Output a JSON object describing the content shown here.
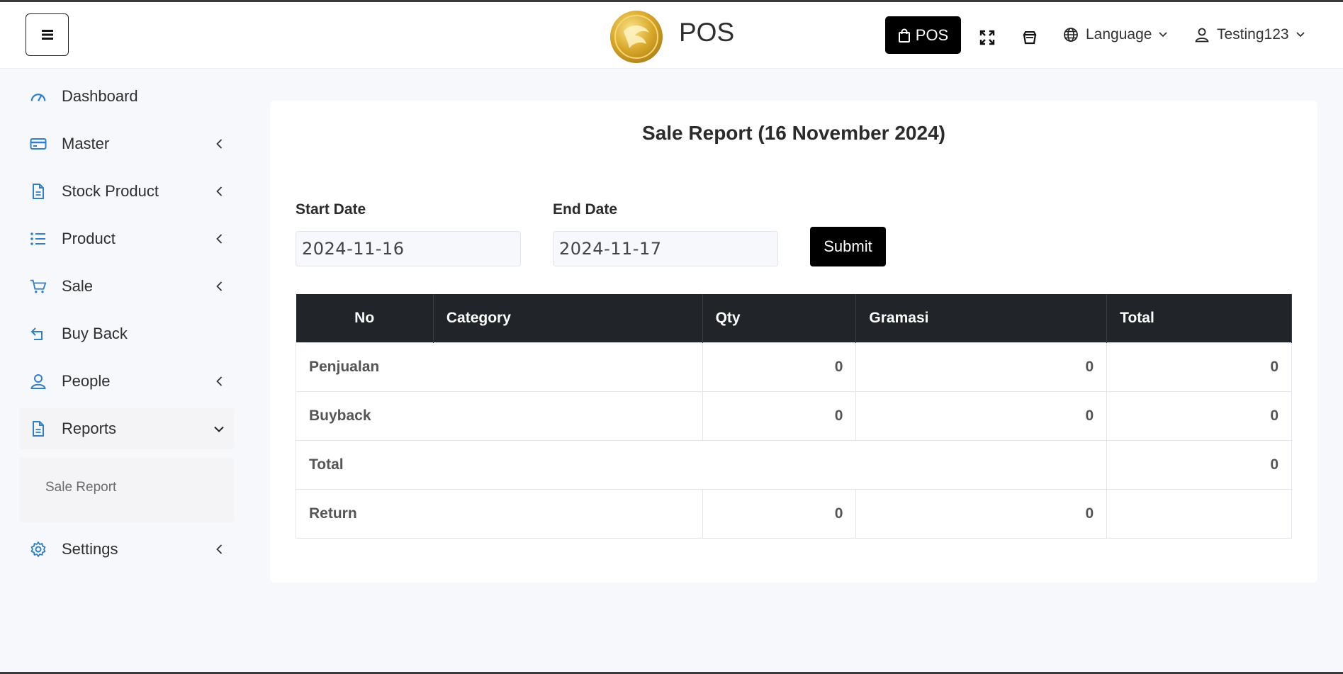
{
  "header": {
    "brand": "POS",
    "pos_button": "POS",
    "language": "Language",
    "user": "Testing123"
  },
  "sidebar": {
    "items": [
      {
        "label": "Dashboard",
        "icon": "dashboard-gauge-icon",
        "has_chevron": false
      },
      {
        "label": "Master",
        "icon": "card-icon",
        "has_chevron": true
      },
      {
        "label": "Stock Product",
        "icon": "document-icon",
        "has_chevron": true
      },
      {
        "label": "Product",
        "icon": "list-icon",
        "has_chevron": true
      },
      {
        "label": "Sale",
        "icon": "cart-icon",
        "has_chevron": true
      },
      {
        "label": "Buy Back",
        "icon": "return-arrow-icon",
        "has_chevron": false
      },
      {
        "label": "People",
        "icon": "user-icon",
        "has_chevron": true
      },
      {
        "label": "Reports",
        "icon": "document-icon",
        "has_chevron": true,
        "expanded": true
      },
      {
        "label": "Settings",
        "icon": "gear-icon",
        "has_chevron": true
      }
    ],
    "reports_submenu": [
      "Sale Report"
    ]
  },
  "main": {
    "title": "Sale Report (16 November 2024)",
    "start_date_label": "Start Date",
    "start_date_value": "2024-11-16",
    "end_date_label": "End Date",
    "end_date_value": "2024-11-17",
    "submit_label": "Submit",
    "table": {
      "headers": [
        "No",
        "Category",
        "Qty",
        "Gramasi",
        "Total"
      ],
      "rows": [
        {
          "category": "Penjualan",
          "qty": "0",
          "gramasi": "0",
          "total": "0"
        },
        {
          "category": "Buyback",
          "qty": "0",
          "gramasi": "0",
          "total": "0"
        },
        {
          "category": "Total",
          "total": "0"
        },
        {
          "category": "Return",
          "qty": "0",
          "gramasi": "0",
          "total": ""
        }
      ]
    }
  },
  "colors": {
    "accent_blue": "#2f80c9",
    "header_dark": "#212529",
    "logo_gold": "#d4a72c"
  }
}
